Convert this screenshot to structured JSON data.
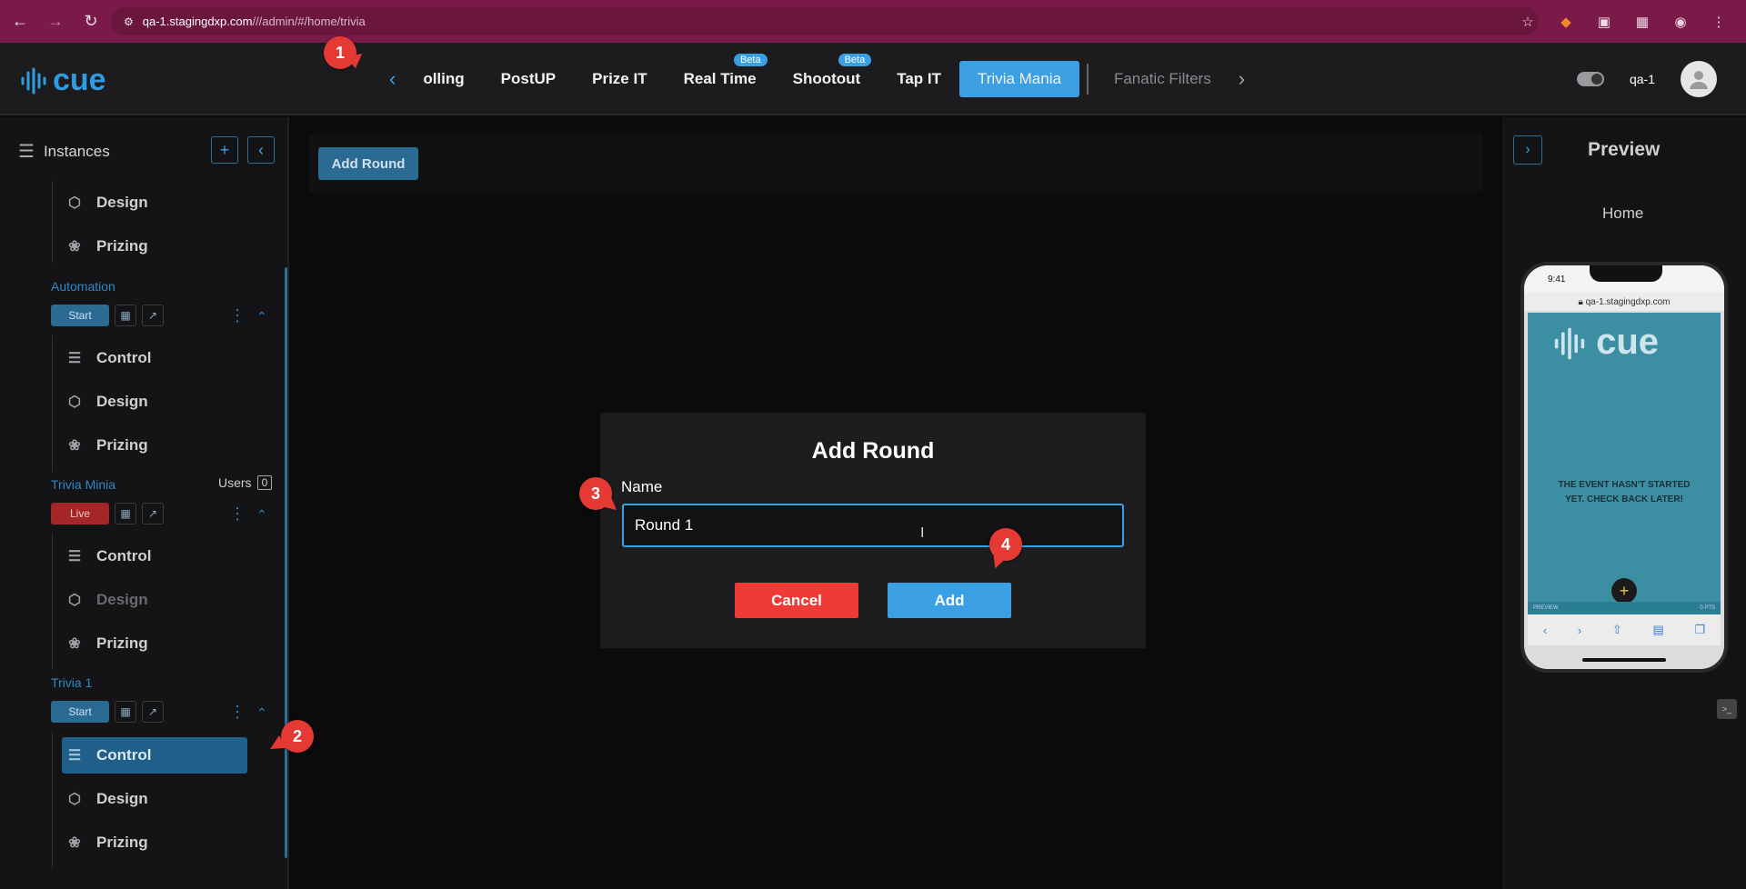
{
  "browser": {
    "url_host": "qa-1.stagingdxp.com",
    "url_path": "///admin/#/home/trivia"
  },
  "header": {
    "logo_text": "cue",
    "tabs": [
      {
        "label": "olling"
      },
      {
        "label": "PostUP"
      },
      {
        "label": "Prize IT"
      },
      {
        "label": "Real Time",
        "badge": "Beta"
      },
      {
        "label": "Shootout",
        "badge": "Beta"
      },
      {
        "label": "Tap IT"
      },
      {
        "label": "Trivia Mania"
      },
      {
        "label": "Fanatic Filters"
      }
    ],
    "user_name": "qa-1"
  },
  "sidebar": {
    "title": "Instances",
    "top_items": [
      {
        "label": "Design"
      },
      {
        "label": "Prizing"
      }
    ],
    "groups": [
      {
        "title": "Automation",
        "status": "Start",
        "items": [
          "Control",
          "Design",
          "Prizing"
        ]
      },
      {
        "title": "Trivia Minia",
        "users_label": "Users",
        "users_count": "0",
        "status": "Live",
        "items": [
          "Control",
          "Design",
          "Prizing"
        ]
      },
      {
        "title": "Trivia 1",
        "status": "Start",
        "items": [
          "Control",
          "Design",
          "Prizing"
        ]
      }
    ]
  },
  "main": {
    "add_round_button": "Add Round"
  },
  "modal": {
    "title": "Add Round",
    "name_label": "Name",
    "name_value": "Round 1",
    "cancel_label": "Cancel",
    "add_label": "Add"
  },
  "preview": {
    "title": "Preview",
    "page": "Home",
    "phone_time": "9:41",
    "phone_url": "qa-1.stagingdxp.com",
    "phone_logo": "cue",
    "phone_message": "The Event hasn't started yet. Check back later!",
    "phone_bar_left": "PREVIEW",
    "phone_bar_right": "0 PTS"
  },
  "markers": [
    "1",
    "2",
    "3",
    "4"
  ],
  "colors": {
    "accent": "#3aa0e3",
    "danger": "#ef3b36",
    "browser_bar": "#7a1a49"
  }
}
